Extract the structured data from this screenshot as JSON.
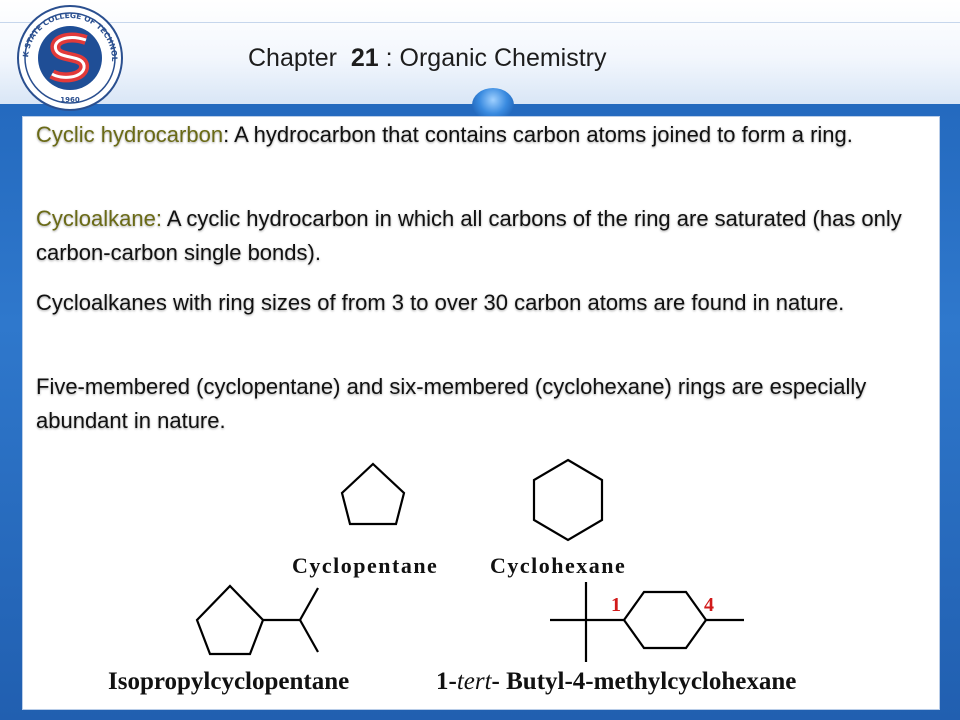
{
  "header": {
    "title_prefix": "Chapter",
    "chapter_number": "21",
    "title_suffix": ": Organic Chemistry",
    "logo_text": "STARK STATE COLLEGE OF TECHNOLOGY",
    "logo_year": "1960"
  },
  "content": {
    "paragraphs": [
      {
        "term": "Cyclic hydrocarbon",
        "text": ": A hydrocarbon that contains carbon atoms joined to form a ring."
      },
      {
        "term": "Cycloalkane:",
        "text": " A cyclic hydrocarbon in which all carbons of the ring are saturated (has only carbon-carbon single bonds)."
      },
      {
        "term": "",
        "text": "Cycloalkanes with ring sizes of from 3 to over 30 carbon atoms are found in nature."
      },
      {
        "term": "",
        "text": "Five-membered (cyclopentane) and six-membered (cyclohexane) rings are especially abundant in nature."
      }
    ]
  },
  "structures": {
    "cyclopentane_label": "Cyclopentane",
    "cyclohexane_label": "Cyclohexane",
    "isopropyl_label": "Isopropylcyclopentane",
    "tbmc_label_prefix": "1-",
    "tbmc_label_italic": "tert",
    "tbmc_label_suffix": "- Butyl-4-methylcyclohexane",
    "position_1": "1",
    "position_4": "4"
  },
  "colors": {
    "term": "#6a6a16",
    "position_number": "#d11a1a",
    "background_blue": "#2f78cc"
  }
}
